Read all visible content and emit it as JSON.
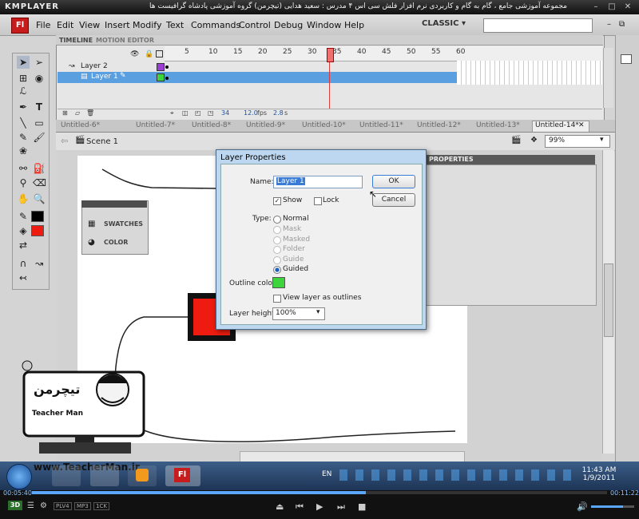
{
  "player": {
    "logo": "KMPLAYER",
    "caption": "مجموعه آموزشی جامع ، گام به گام و کاربردی نرم افزار فلش سی اس ۴ مدرس : سعید هدایی (تیچرمن) گروه آموزشی پادشاه گرافیست ها",
    "time_elapsed": "00:05:40",
    "time_total": "00:11:22",
    "progress_fraction": 0.58,
    "badges": [
      "PLV4",
      "MP3",
      "1CK"
    ],
    "mode_3d": "3D"
  },
  "app": {
    "logo": "Fl",
    "menu": [
      "File",
      "Edit",
      "View",
      "Insert",
      "Modify",
      "Text",
      "Commands",
      "Control",
      "Debug",
      "Window",
      "Help"
    ],
    "workspace": "CLASSIC"
  },
  "timeline": {
    "tabs": [
      "TIMELINE",
      "MOTION EDITOR"
    ],
    "ruler": [
      "5",
      "10",
      "15",
      "20",
      "25",
      "30",
      "35",
      "40",
      "45",
      "50",
      "55",
      "60"
    ],
    "layers": [
      {
        "name": "Layer 2",
        "color": "#9b3fd4"
      },
      {
        "name": "Layer 1",
        "color": "#3dd43d"
      }
    ],
    "current_frame": "34",
    "fps": "12.0",
    "fps_unit": "fps",
    "time": "2.8",
    "time_unit": "s"
  },
  "doc_tabs": [
    "Untitled-6*",
    "Untitled-7*",
    "Untitled-8*",
    "Untitled-9*",
    "Untitled-10*",
    "Untitled-11*",
    "Untitled-12*",
    "Untitled-13*",
    "Untitled-14*"
  ],
  "scene": {
    "label": "Scene 1",
    "zoom": "99%"
  },
  "panels": {
    "swatches": "SWATCHES",
    "color": "COLOR",
    "properties": "PROPERTIES"
  },
  "dialog": {
    "title": "Layer Properties",
    "name_label": "Name:",
    "name_value": "Layer 1",
    "ok": "OK",
    "cancel": "Cancel",
    "show": "Show",
    "lock": "Lock",
    "type_label": "Type:",
    "types": [
      {
        "label": "Normal",
        "enabled": true,
        "selected": false
      },
      {
        "label": "Mask",
        "enabled": false,
        "selected": false
      },
      {
        "label": "Masked",
        "enabled": false,
        "selected": false
      },
      {
        "label": "Folder",
        "enabled": false,
        "selected": false
      },
      {
        "label": "Guide",
        "enabled": false,
        "selected": false
      },
      {
        "label": "Guided",
        "enabled": true,
        "selected": true
      }
    ],
    "outline_label": "Outline color:",
    "outline_color": "#3dd43d",
    "view_outlines": "View layer as outlines",
    "height_label": "Layer height:",
    "height_value": "100%"
  },
  "taskbar": {
    "lang": "EN",
    "time": "11:43 AM",
    "date": "1/9/2011"
  },
  "watermark": {
    "url": "www.TeacherMan.ir",
    "brand": "Teacher Man"
  },
  "colors": {
    "stroke": "#000000",
    "fill": "#ee1c10"
  }
}
